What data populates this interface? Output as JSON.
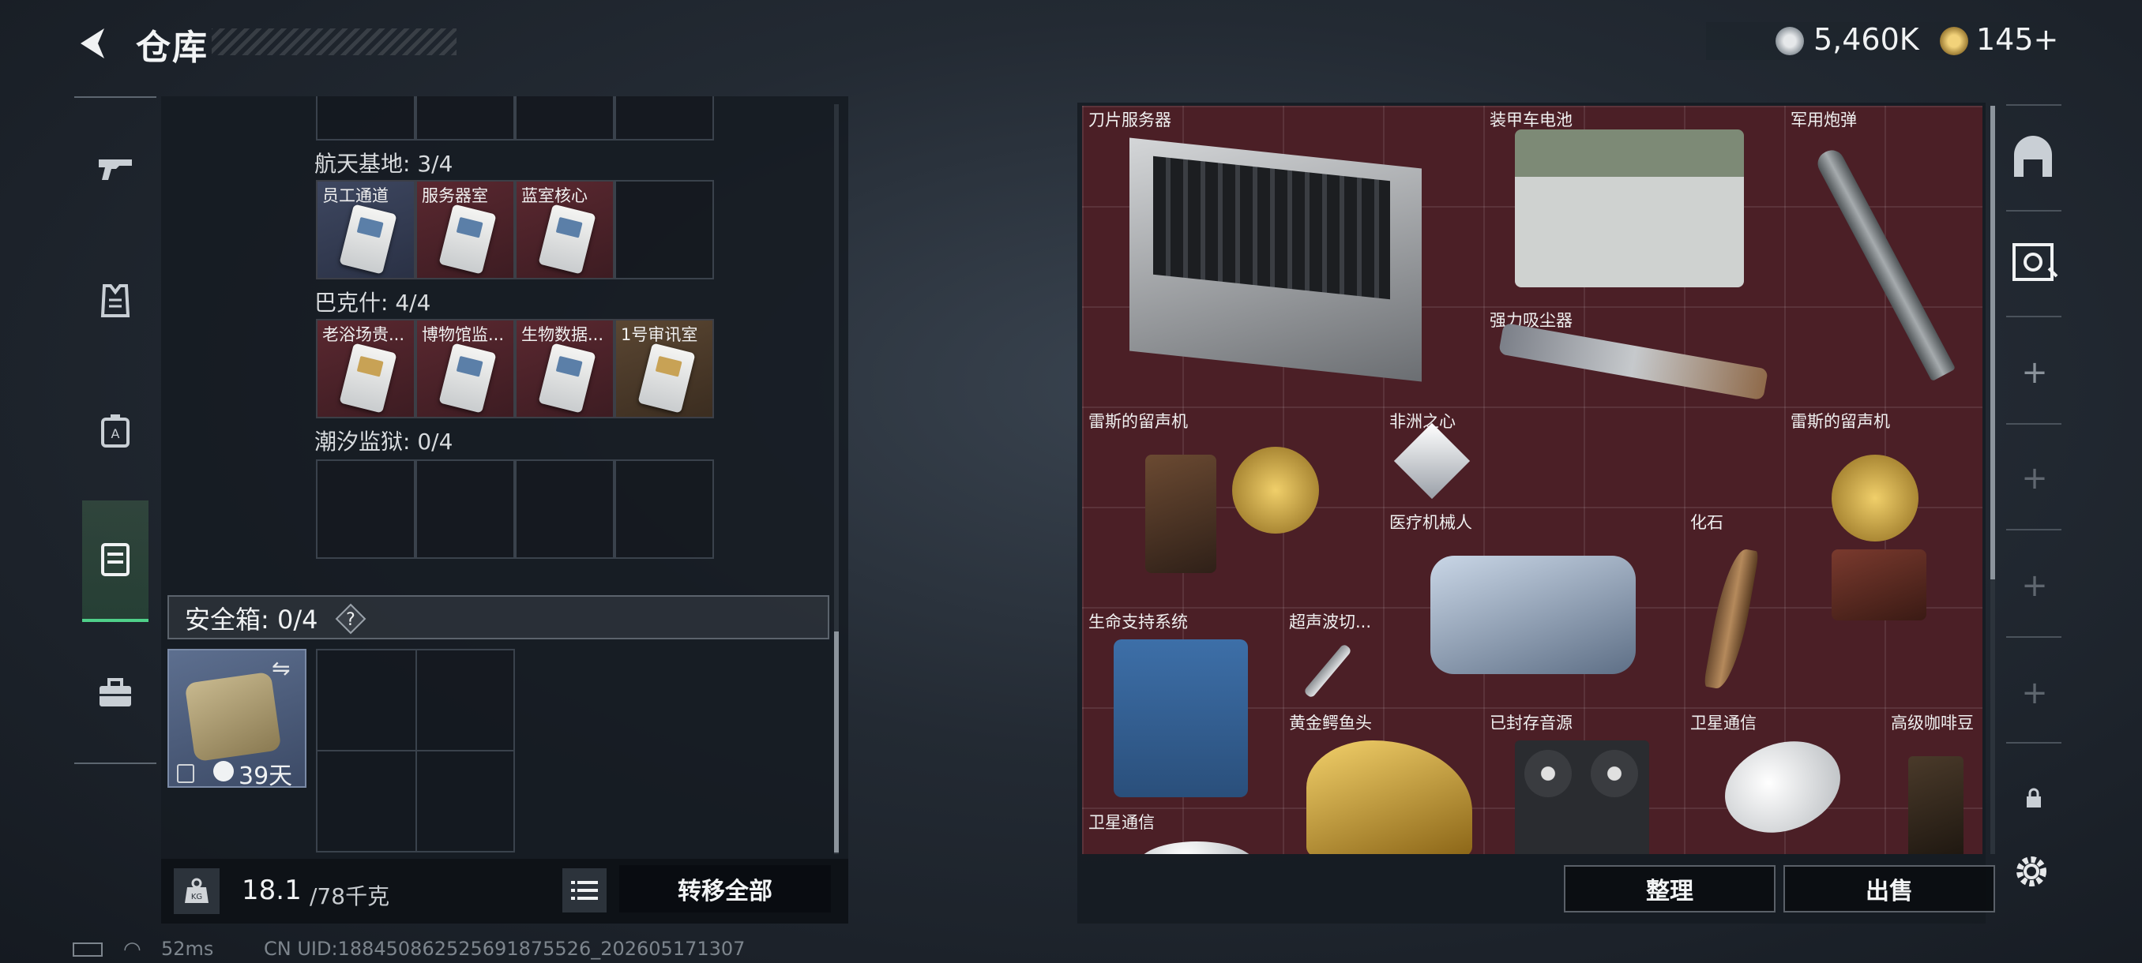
{
  "header": {
    "title": "仓库",
    "currency": [
      {
        "icon": "silver-coin-icon",
        "value": "5,460K"
      },
      {
        "icon": "gold-coin-icon",
        "value": "145+"
      }
    ]
  },
  "left_nav": [
    "gun-icon",
    "armor-vest-icon",
    "backpack-icon",
    "chest-rig-icon",
    "briefcase-icon"
  ],
  "inventory": {
    "sections": [
      {
        "label": "航天基地: 3/4",
        "cards": [
          {
            "name": "员工通道",
            "color": "blue"
          },
          {
            "name": "服务器室",
            "color": "red"
          },
          {
            "name": "蓝室核心",
            "color": "red"
          }
        ]
      },
      {
        "label": "巴克什: 4/4",
        "cards": [
          {
            "name": "老浴场贵...",
            "color": "red"
          },
          {
            "name": "博物馆监...",
            "color": "red"
          },
          {
            "name": "生物数据...",
            "color": "red"
          },
          {
            "name": "1号审讯室",
            "color": "gold"
          }
        ]
      },
      {
        "label": "潮汐监狱: 0/4",
        "cards": []
      }
    ],
    "safe_box": {
      "label": "安全箱: 0/4",
      "help": "?",
      "duration": "39天"
    },
    "weight": {
      "current": "18.1",
      "max": "/78千克"
    },
    "transfer_all": "转移全部"
  },
  "stash": {
    "items": [
      {
        "name": "刀片服务器"
      },
      {
        "name": "装甲车电池"
      },
      {
        "name": "军用炮弹"
      },
      {
        "name": "强力吸尘器"
      },
      {
        "name": "雷斯的留声机"
      },
      {
        "name": "非洲之心"
      },
      {
        "name": "雷斯的留声机"
      },
      {
        "name": "医疗机械人"
      },
      {
        "name": "化石"
      },
      {
        "name": "生命支持系统"
      },
      {
        "name": "超声波切..."
      },
      {
        "name": "黄金鳄鱼头"
      },
      {
        "name": "已封存音源"
      },
      {
        "name": "卫星通信"
      },
      {
        "name": "高级咖啡豆"
      },
      {
        "name": "卫星通信"
      }
    ],
    "tidy_button": "整理",
    "sell_button": "出售"
  },
  "status_bar": {
    "ping": "52ms",
    "uid": "CN UID:1884508625256918755​26_202605171307"
  }
}
